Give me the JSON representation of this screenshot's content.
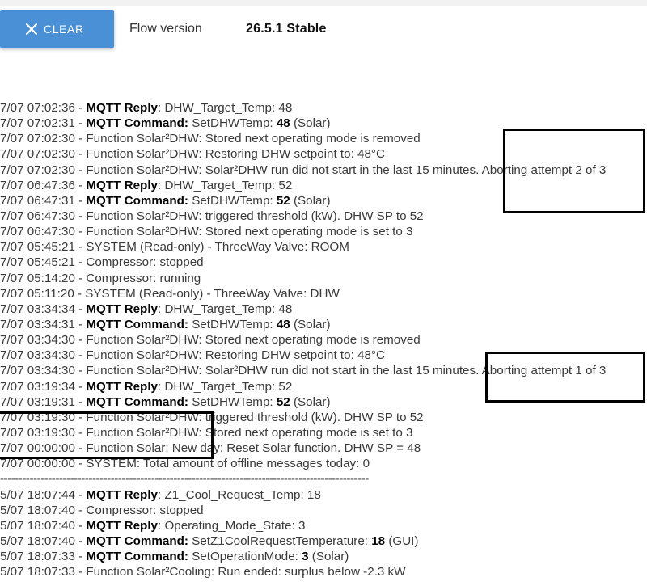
{
  "header": {
    "clear_button": {
      "label": "CLEAR",
      "icon": "close-icon"
    },
    "flow_version_label": "Flow version",
    "flow_version_value": "26.5.1 Stable"
  },
  "colors": {
    "clear_button": "#4a90d6",
    "highlight_box": "#000000"
  },
  "log": [
    [
      {
        "t": "7/07 07:02:36 - "
      },
      {
        "t": "MQTT Reply",
        "b": true
      },
      {
        "t": ": DHW_Target_Temp: 48"
      }
    ],
    [
      {
        "t": "7/07 07:02:31 - "
      },
      {
        "t": "MQTT Command:",
        "b": true
      },
      {
        "t": " SetDHWTemp: "
      },
      {
        "t": "48",
        "b": true
      },
      {
        "t": " (Solar)"
      }
    ],
    [
      {
        "t": "7/07 07:02:30 - Function Solar²DHW: Stored next operating mode is removed"
      }
    ],
    [
      {
        "t": "7/07 07:02:30 - Function Solar²DHW: Restoring DHW setpoint to: 48°C"
      }
    ],
    [
      {
        "t": "7/07 07:02:30 - Function Solar²DHW: Solar²DHW run did not start in the last 15 minutes. Aborting attempt 2 of 3"
      }
    ],
    [
      {
        "t": "7/07 06:47:36 - "
      },
      {
        "t": "MQTT Reply",
        "b": true
      },
      {
        "t": ": DHW_Target_Temp: 52"
      }
    ],
    [
      {
        "t": "7/07 06:47:31 - "
      },
      {
        "t": "MQTT Command:",
        "b": true
      },
      {
        "t": " SetDHWTemp: "
      },
      {
        "t": "52",
        "b": true
      },
      {
        "t": " (Solar)"
      }
    ],
    [
      {
        "t": "7/07 06:47:30 - Function Solar²DHW: triggered threshold (kW). DHW SP to 52"
      }
    ],
    [
      {
        "t": "7/07 06:47:30 - Function Solar²DHW: Stored next operating mode is set to 3"
      }
    ],
    [
      {
        "t": "7/07 05:45:21 - SYSTEM (Read-only) - ThreeWay Valve: ROOM"
      }
    ],
    [
      {
        "t": "7/07 05:45:21 - Compressor: stopped"
      }
    ],
    [
      {
        "t": "7/07 05:14:20 - Compressor: running"
      }
    ],
    [
      {
        "t": "7/07 05:11:20 - SYSTEM (Read-only) - ThreeWay Valve: DHW"
      }
    ],
    [
      {
        "t": "7/07 03:34:34 - "
      },
      {
        "t": "MQTT Reply",
        "b": true
      },
      {
        "t": ": DHW_Target_Temp: 48"
      }
    ],
    [
      {
        "t": "7/07 03:34:31 - "
      },
      {
        "t": "MQTT Command:",
        "b": true
      },
      {
        "t": " SetDHWTemp: "
      },
      {
        "t": "48",
        "b": true
      },
      {
        "t": " (Solar)"
      }
    ],
    [
      {
        "t": "7/07 03:34:30 - Function Solar²DHW: Stored next operating mode is removed"
      }
    ],
    [
      {
        "t": "7/07 03:34:30 - Function Solar²DHW: Restoring DHW setpoint to: 48°C"
      }
    ],
    [
      {
        "t": "7/07 03:34:30 - Function Solar²DHW: Solar²DHW run did not start in the last 15 minutes. Aborting attempt 1 of 3"
      }
    ],
    [
      {
        "t": "7/07 03:19:34 - "
      },
      {
        "t": "MQTT Reply",
        "b": true
      },
      {
        "t": ": DHW_Target_Temp: 52"
      }
    ],
    [
      {
        "t": "7/07 03:19:31 - "
      },
      {
        "t": "MQTT Command:",
        "b": true
      },
      {
        "t": " SetDHWTemp: "
      },
      {
        "t": "52",
        "b": true
      },
      {
        "t": " (Solar)"
      }
    ],
    [
      {
        "t": "7/07 03:19:30 - Function Solar²DHW: triggered threshold (kW). DHW SP to 52"
      }
    ],
    [
      {
        "t": "7/07 03:19:30 - Function Solar²DHW: Stored next operating mode is set to 3"
      }
    ],
    [
      {
        "t": "7/07 00:00:00 - Function Solar: New day; Reset Solar function. DHW SP = 48"
      }
    ],
    [
      {
        "t": "7/07 00:00:00 - SYSTEM: Total amount of offline messages today: 0"
      }
    ],
    [
      {
        "t": "----------------------------------------------------------------------------------------------------",
        "sep": true
      }
    ],
    [
      {
        "t": "5/07 18:07:44 - "
      },
      {
        "t": "MQTT Reply",
        "b": true
      },
      {
        "t": ": Z1_Cool_Request_Temp: 18"
      }
    ],
    [
      {
        "t": "5/07 18:07:40 - Compressor: stopped"
      }
    ],
    [
      {
        "t": "5/07 18:07:40 - "
      },
      {
        "t": "MQTT Reply",
        "b": true
      },
      {
        "t": ": Operating_Mode_State: 3"
      }
    ],
    [
      {
        "t": "5/07 18:07:40 - "
      },
      {
        "t": "MQTT Command:",
        "b": true
      },
      {
        "t": " SetZ1CoolRequestTemperature: "
      },
      {
        "t": "18",
        "b": true
      },
      {
        "t": " (GUI)"
      }
    ],
    [
      {
        "t": "5/07 18:07:33 - "
      },
      {
        "t": "MQTT Command:",
        "b": true
      },
      {
        "t": " SetOperationMode: "
      },
      {
        "t": "3",
        "b": true
      },
      {
        "t": " (Solar)"
      }
    ],
    [
      {
        "t": "5/07 18:07:33 - Function Solar²Cooling: Run ended: surplus below -2.3 kW"
      }
    ]
  ]
}
